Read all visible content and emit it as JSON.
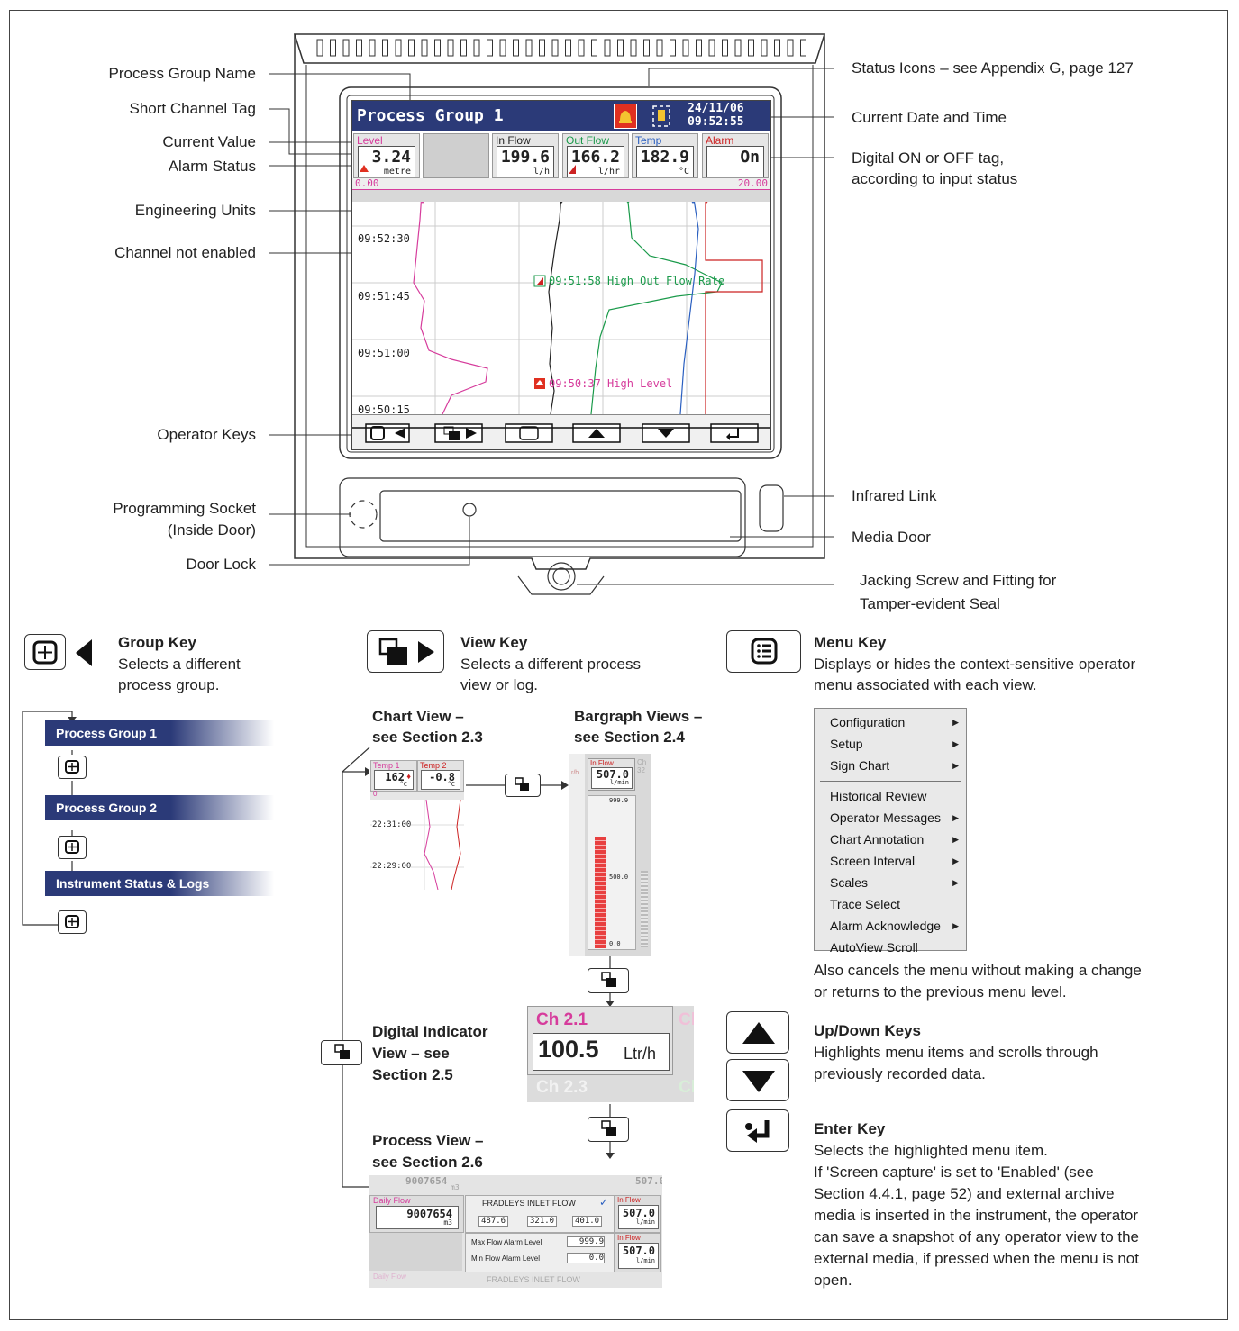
{
  "instrument": {
    "group_title": "Process Group 1",
    "date": "24/11/06",
    "time": "09:52:55",
    "scale_min": "0.00",
    "scale_max": "20.00",
    "channels": [
      {
        "tag": "Level",
        "value": "3.24",
        "unit": "metre",
        "color": "#d63c9c"
      },
      {
        "tag": "",
        "value": "",
        "unit": "",
        "color": "#999999"
      },
      {
        "tag": "In Flow",
        "value": "199.6",
        "unit": "l/h",
        "color": "#222222"
      },
      {
        "tag": "Out Flow",
        "value": "166.2",
        "unit": "l/hr",
        "color": "#1a9a4a"
      },
      {
        "tag": "Temp",
        "value": "182.9",
        "unit": "°C",
        "color": "#2a5fc0"
      },
      {
        "tag": "Alarm",
        "value": "On",
        "unit": "",
        "color": "#cc2222"
      }
    ],
    "time_labels": [
      "09:52:30",
      "09:51:45",
      "09:51:00",
      "09:50:15"
    ],
    "annotation_outflow": "09:51:58 High Out Flow Rate",
    "annotation_level": "09:50:37 High Level"
  },
  "callouts": {
    "process_group_name": "Process Group Name",
    "short_channel_tag": "Short Channel Tag",
    "current_value": "Current Value",
    "alarm_status": "Alarm Status",
    "engineering_units": "Engineering Units",
    "channel_not_enabled": "Channel not enabled",
    "operator_keys": "Operator Keys",
    "programming_socket_1": "Programming Socket",
    "programming_socket_2": "(Inside Door)",
    "door_lock": "Door Lock",
    "status_icons": "Status Icons – see Appendix G, page 127",
    "current_date_time": "Current Date and Time",
    "digital_tag_1": "Digital ON or OFF tag,",
    "digital_tag_2": "according to input status",
    "infrared_link": "Infrared Link",
    "media_door": "Media Door",
    "jacking_1": "Jacking Screw and Fitting for",
    "jacking_2": "Tamper-evident Seal"
  },
  "group_key": {
    "title": "Group Key",
    "desc_1": "Selects a different",
    "desc_2": "process group.",
    "groups": [
      "Process Group 1",
      "Process Group 2",
      "Instrument Status & Logs"
    ]
  },
  "view_key": {
    "title": "View Key",
    "desc_1": "Selects a different process",
    "desc_2": "view or log.",
    "chart_view_1": "Chart View –",
    "chart_view_2": "see Section 2.3",
    "bargraph_1": "Bargraph Views –",
    "bargraph_2": "see Section 2.4",
    "digital_1": "Digital Indicator",
    "digital_2": "View – see",
    "digital_3": "Section 2.5",
    "process_1": "Process View –",
    "process_2": "see Section 2.6"
  },
  "chart_thumb": {
    "t1_tag": "Temp 1",
    "t1_val": "162",
    "t1_unit": "°C",
    "t2_tag": "Temp 2",
    "t2_val": "-0.8",
    "t2_unit": "°C",
    "scale0": "0",
    "times": [
      "22:31:00",
      "22:29:00"
    ]
  },
  "bar_thumb": {
    "tag": "In Flow",
    "val": "507.0",
    "unit": "l/min",
    "max": "999.9",
    "mid": "500.0",
    "min": "0.0",
    "left_tick": "r/h",
    "right_tag": "Ch",
    "right_val": "32"
  },
  "digital_thumb": {
    "tag1": "Ch 2.1",
    "val": "100.5",
    "unit": "Ltr/h",
    "tag3": "Ch 2.3",
    "side1": "Ch",
    "side2": "Cl"
  },
  "process_thumb": {
    "daily_tag": "Daily Flow",
    "daily_val": "9007654",
    "daily_unit": "m3",
    "name": "FRADLEYS INLET FLOW",
    "v1": "487.6",
    "v2": "321.0",
    "v3": "401.0",
    "inflow_tag": "In Flow",
    "inflow_val": "507.0",
    "inflow_unit": "l/min",
    "max_label": "Max Flow Alarm Level",
    "max_val": "999.9",
    "min_label": "Min Flow Alarm Level",
    "min_val": "0.0",
    "top_val": "9007654",
    "top_unit": "m3",
    "top_r": "507.0"
  },
  "menu_key": {
    "title": "Menu Key",
    "desc_1": "Displays or hides the context-sensitive operator",
    "desc_2": "menu associated with each view.",
    "items": [
      "Configuration",
      "Setup",
      "Sign Chart",
      "Historical Review",
      "Operator Messages",
      "Chart Annotation",
      "Screen Interval",
      "Scales",
      "Trace Select",
      "Alarm Acknowledge",
      "AutoView Scroll"
    ],
    "cancel_1": "Also cancels the menu without making a change",
    "cancel_2": "or returns to the previous menu level."
  },
  "updown_key": {
    "title": "Up/Down Keys",
    "desc_1": "Highlights menu items and scrolls through",
    "desc_2": "previously recorded data."
  },
  "enter_key": {
    "title": "Enter Key",
    "desc_1": "Selects the highlighted menu item.",
    "desc_2": "If 'Screen capture' is set to 'Enabled' (see",
    "desc_3": "Section 4.4.1, page 52) and external archive",
    "desc_4": "media is inserted in the instrument, the operator",
    "desc_5": "can save a snapshot of any operator view to the",
    "desc_6": "external media, if pressed when the menu is not",
    "desc_7": "open."
  }
}
